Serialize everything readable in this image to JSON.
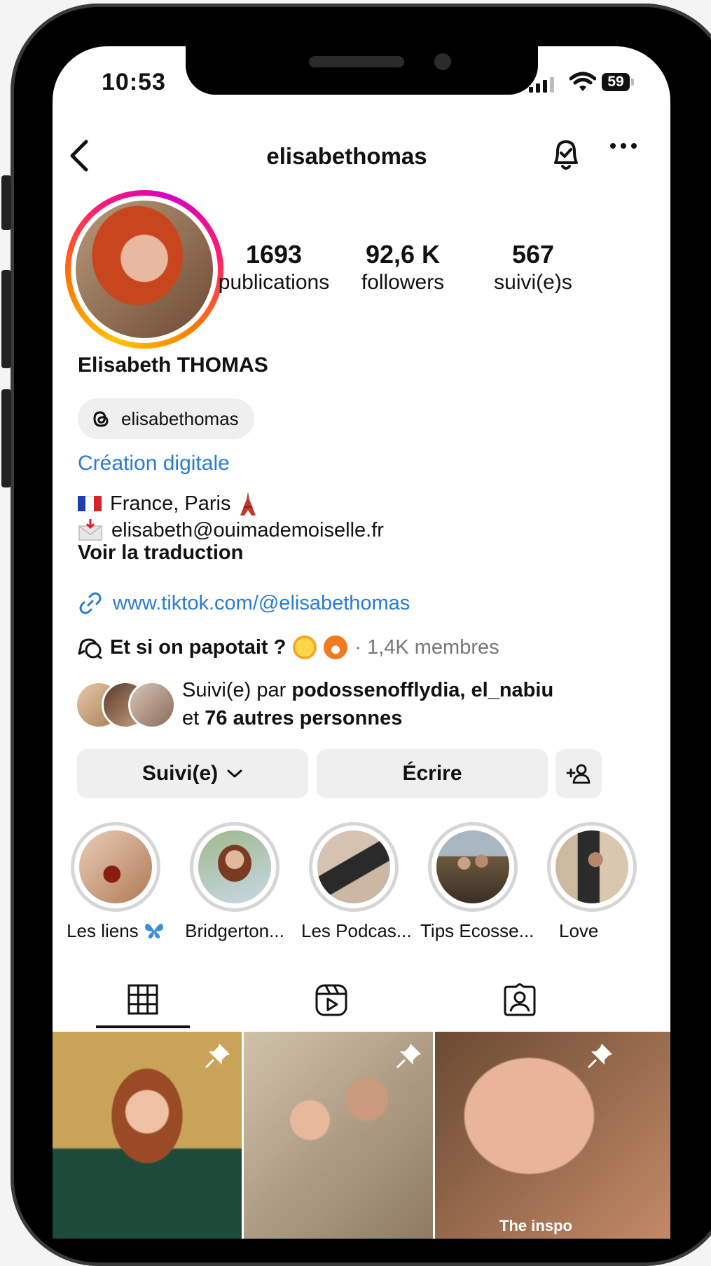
{
  "status_bar": {
    "time": "10:53",
    "battery": "59"
  },
  "header": {
    "username": "elisabethomas"
  },
  "stats": [
    {
      "value": "1693",
      "label": "publications"
    },
    {
      "value": "92,6 K",
      "label": "followers"
    },
    {
      "value": "567",
      "label": "suivi(e)s"
    }
  ],
  "profile": {
    "full_name": "Elisabeth THOMAS",
    "threads_handle": "elisabethomas",
    "category": "Création digitale",
    "location": "France, Paris",
    "email": "elisabeth@ouimademoiselle.fr",
    "translate_label": "Voir la traduction",
    "link": "www.tiktok.com/@elisabethomas"
  },
  "channel": {
    "name": "Et si on papotait ?",
    "members": "· 1,4K membres"
  },
  "followed_by": {
    "prefix": "Suivi(e) par ",
    "names": "podossenofflydia, el_nabiu",
    "middle": "et ",
    "others": "76 autres personnes"
  },
  "actions": {
    "following_label": "Suivi(e)",
    "message_label": "Écrire"
  },
  "highlights": [
    {
      "label": "Les liens"
    },
    {
      "label": "Bridgerton..."
    },
    {
      "label": "Les Podcas..."
    },
    {
      "label": "Tips Ecosse..."
    },
    {
      "label": "Love"
    }
  ],
  "grid_posts": [
    {
      "caption": ""
    },
    {
      "caption": ""
    },
    {
      "caption": "The inspo"
    }
  ],
  "colors": {
    "link_blue": "#2a7ad8",
    "button_gray": "#efefef",
    "story_ring_start": "#ffc400",
    "story_ring_end": "#d300c5"
  },
  "icons": [
    "back-chevron-icon",
    "bell-check-icon",
    "more-dots-icon",
    "threads-icon",
    "link-icon",
    "channel-icon",
    "chevron-down-icon",
    "add-person-icon",
    "grid-icon",
    "reels-icon",
    "tagged-icon",
    "pin-icon"
  ]
}
